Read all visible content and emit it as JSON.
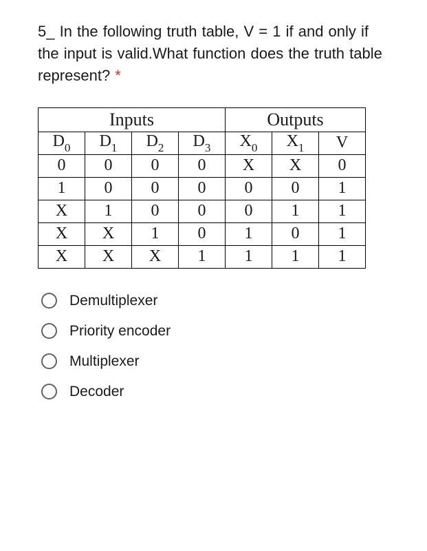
{
  "question": {
    "prefix": "5_ In the following truth table, V = 1 if and only if the input is valid.What function does the truth table represent? ",
    "required_marker": "*"
  },
  "table": {
    "section_headers": {
      "inputs": "Inputs",
      "outputs": "Outputs"
    },
    "col_headers": {
      "d0_main": "D",
      "d0_sub": "0",
      "d1_main": "D",
      "d1_sub": "1",
      "d2_main": "D",
      "d2_sub": "2",
      "d3_main": "D",
      "d3_sub": "3",
      "x0_main": "X",
      "x0_sub": "0",
      "x1_main": "X",
      "x1_sub": "1",
      "v": "V"
    },
    "rows": [
      {
        "c0": "0",
        "c1": "0",
        "c2": "0",
        "c3": "0",
        "c4": "X",
        "c5": "X",
        "c6": "0"
      },
      {
        "c0": "1",
        "c1": "0",
        "c2": "0",
        "c3": "0",
        "c4": "0",
        "c5": "0",
        "c6": "1"
      },
      {
        "c0": "X",
        "c1": "1",
        "c2": "0",
        "c3": "0",
        "c4": "0",
        "c5": "1",
        "c6": "1"
      },
      {
        "c0": "X",
        "c1": "X",
        "c2": "1",
        "c3": "0",
        "c4": "1",
        "c5": "0",
        "c6": "1"
      },
      {
        "c0": "X",
        "c1": "X",
        "c2": "X",
        "c3": "1",
        "c4": "1",
        "c5": "1",
        "c6": "1"
      }
    ]
  },
  "options": [
    {
      "label": "Demultiplexer"
    },
    {
      "label": "Priority encoder"
    },
    {
      "label": "Multiplexer"
    },
    {
      "label": "Decoder"
    }
  ],
  "chart_data": {
    "type": "table",
    "title": "Truth table",
    "columns": [
      "D0",
      "D1",
      "D2",
      "D3",
      "X0",
      "X1",
      "V"
    ],
    "section_spans": {
      "Inputs": [
        "D0",
        "D1",
        "D2",
        "D3"
      ],
      "Outputs": [
        "X0",
        "X1",
        "V"
      ]
    },
    "rows": [
      [
        "0",
        "0",
        "0",
        "0",
        "X",
        "X",
        "0"
      ],
      [
        "1",
        "0",
        "0",
        "0",
        "0",
        "0",
        "1"
      ],
      [
        "X",
        "1",
        "0",
        "0",
        "0",
        "1",
        "1"
      ],
      [
        "X",
        "X",
        "1",
        "0",
        "1",
        "0",
        "1"
      ],
      [
        "X",
        "X",
        "X",
        "1",
        "1",
        "1",
        "1"
      ]
    ]
  }
}
